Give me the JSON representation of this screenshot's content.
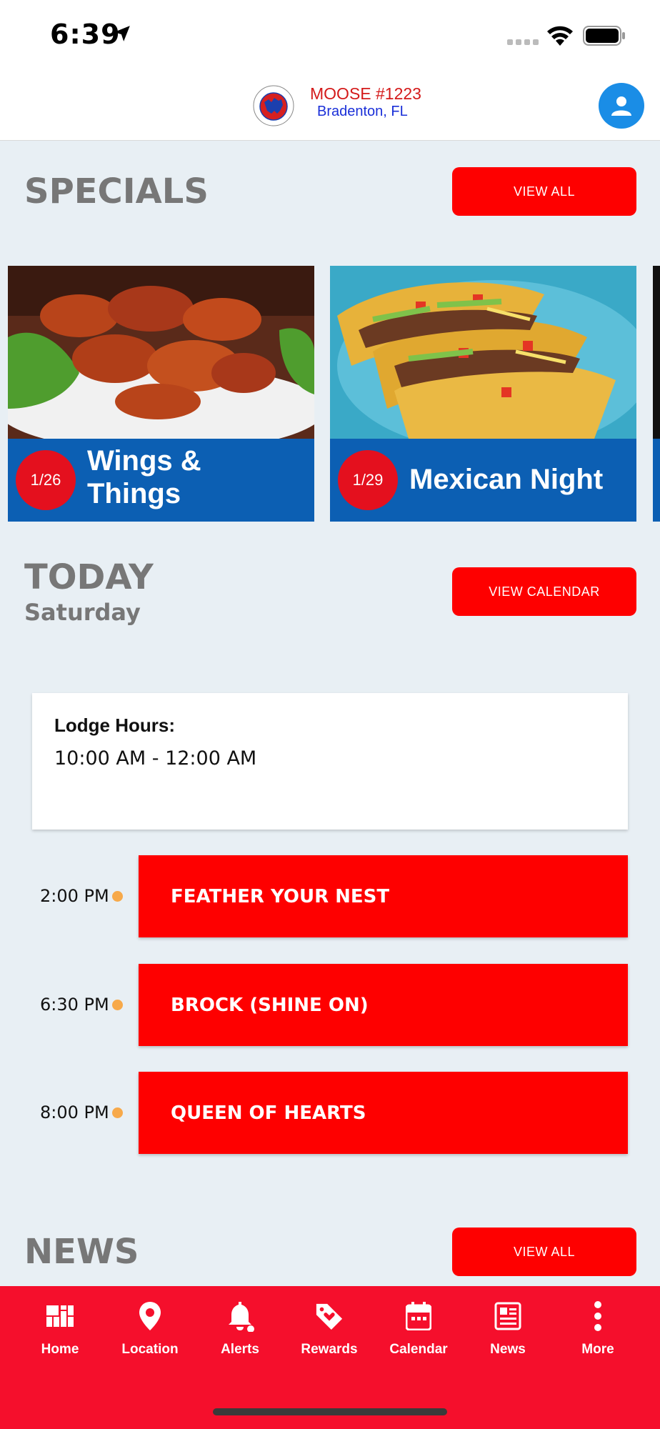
{
  "status_bar": {
    "time": "6:39"
  },
  "header": {
    "brand_title": "MOOSE #1223",
    "brand_subtitle": "Bradenton, FL",
    "logo_text": "MOOSE LODGE #1223"
  },
  "specials": {
    "title": "SPECIALS",
    "view_all_label": "VIEW ALL",
    "cards": [
      {
        "date": "1/26",
        "title_line1": "Wings &",
        "title_line2": "Things"
      },
      {
        "date": "1/29",
        "title": "Mexican Night"
      }
    ]
  },
  "today": {
    "title": "TODAY",
    "day": "Saturday",
    "view_calendar_label": "VIEW CALENDAR",
    "hours_label": "Lodge Hours:",
    "hours_value": "10:00 AM - 12:00 AM",
    "events": [
      {
        "time": "2:00 PM",
        "title": "FEATHER YOUR NEST"
      },
      {
        "time": "6:30 PM",
        "title": "BROCK (SHINE ON)"
      },
      {
        "time": "8:00 PM",
        "title": "QUEEN OF HEARTS"
      }
    ]
  },
  "news": {
    "title": "NEWS",
    "view_all_label": "VIEW ALL"
  },
  "tabbar": {
    "tabs": [
      {
        "label": "Home",
        "icon": "home-grid-icon"
      },
      {
        "label": "Location",
        "icon": "location-pin-icon"
      },
      {
        "label": "Alerts",
        "icon": "bell-icon"
      },
      {
        "label": "Rewards",
        "icon": "tag-heart-icon"
      },
      {
        "label": "Calendar",
        "icon": "calendar-icon"
      },
      {
        "label": "News",
        "icon": "newspaper-icon"
      },
      {
        "label": "More",
        "icon": "more-vertical-icon"
      }
    ]
  },
  "colors": {
    "accent_red": "#fe0000",
    "tabbar_red": "#f50f2c",
    "card_blue": "#0c5fb3",
    "profile_blue": "#1a8de6",
    "dot_orange": "#f7a94a"
  }
}
